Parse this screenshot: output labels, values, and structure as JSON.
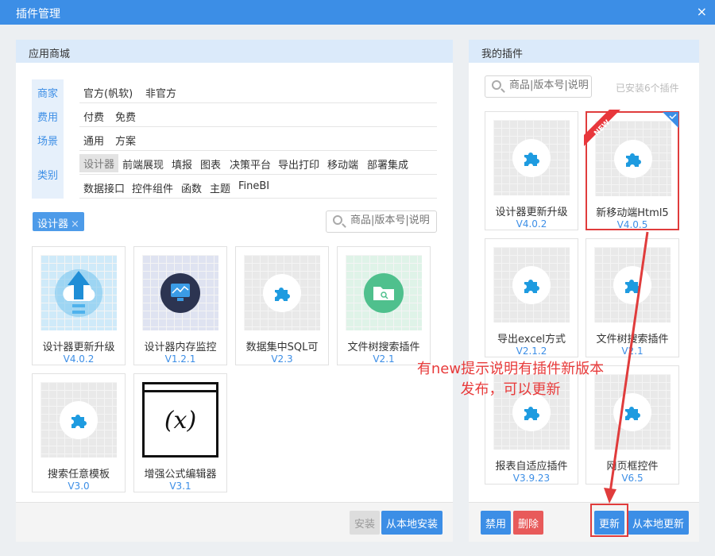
{
  "window": {
    "title": "插件管理",
    "close_glyph": "×"
  },
  "store": {
    "header": "应用商城",
    "filters": {
      "merchant": {
        "label": "商家",
        "options": [
          "官方(帆软)",
          "非官方"
        ]
      },
      "fee": {
        "label": "费用",
        "options": [
          "付费",
          "免费"
        ]
      },
      "scene": {
        "label": "场景",
        "options": [
          "通用",
          "方案"
        ]
      },
      "category": {
        "label": "类别",
        "options": [
          "设计器",
          "前端展现",
          "填报",
          "图表",
          "决策平台",
          "导出打印",
          "移动端",
          "部署集成",
          "数据接口",
          "控件组件",
          "函数",
          "主题",
          "FineBI"
        ],
        "selected": "设计器"
      }
    },
    "active_tag": {
      "label": "设计器",
      "remove_glyph": "×"
    },
    "search_placeholder": "商品|版本号|说明",
    "cards": [
      {
        "name": "设计器更新升级",
        "version": "V4.0.2",
        "icon": "cloud-upload-icon"
      },
      {
        "name": "设计器内存监控",
        "version": "V1.2.1",
        "icon": "gauge-icon"
      },
      {
        "name": "数据集中SQL可",
        "version": "V2.3",
        "icon": "puzzle-icon"
      },
      {
        "name": "文件树搜索插件",
        "version": "V2.1",
        "icon": "folder-search-icon"
      },
      {
        "name": "搜索任意模板",
        "version": "V3.0",
        "icon": "puzzle-icon"
      },
      {
        "name": "增强公式编辑器",
        "version": "V3.1",
        "icon": "formula-icon",
        "icon_text": "(x)"
      }
    ],
    "buttons": {
      "install": "安装",
      "install_local": "从本地安装"
    }
  },
  "mine": {
    "header": "我的插件",
    "search_placeholder": "商品|版本号|说明",
    "installed_count": "已安装6个插件",
    "cards": [
      {
        "name": "设计器更新升级",
        "version": "V4.0.2",
        "icon": "puzzle-icon"
      },
      {
        "name": "新移动端Html5",
        "version": "V4.0.5",
        "icon": "puzzle-icon",
        "badge": "NEW",
        "selected": true
      },
      {
        "name": "导出excel方式",
        "version": "V2.1.2",
        "icon": "puzzle-icon"
      },
      {
        "name": "文件树搜索插件",
        "version": "V2.1",
        "icon": "puzzle-icon"
      },
      {
        "name": "报表自适应插件",
        "version": "V3.9.23",
        "icon": "puzzle-icon"
      },
      {
        "name": "网页框控件",
        "version": "V6.5",
        "icon": "puzzle-icon"
      }
    ],
    "buttons": {
      "disable": "禁用",
      "delete": "删除",
      "update": "更新",
      "update_local": "从本地更新"
    }
  },
  "annotation": {
    "line1": "有new提示说明有插件新版本",
    "line2": "发布，可以更新"
  },
  "colors": {
    "accent": "#3c8ee6",
    "header_bg": "#dbeafa",
    "highlight": "#e03c3c",
    "puzzle": "#1e9be0"
  }
}
